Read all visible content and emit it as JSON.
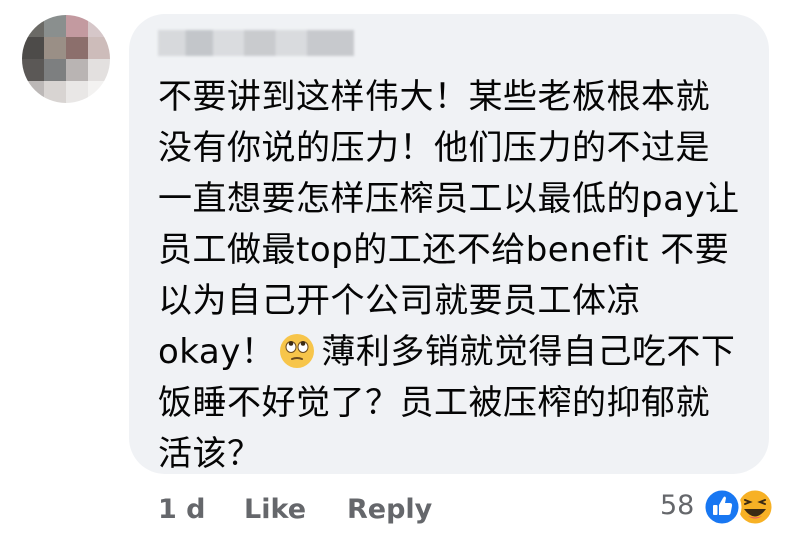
{
  "comment": {
    "author": "████████",
    "lines": [
      "不要讲到这样伟大！某些老板根本就",
      "没有你说的压力！他们压力的不过是",
      "一直想要怎样压榨员工以最低的pay让",
      "员工做最top的工还不给benefit 不要",
      "以为自己开个公司就要员工体凉",
      "okay！",
      "薄利多销就觉得自己吃不下",
      "饭睡不好觉了？员工被压榨的抑郁就",
      "活该？"
    ],
    "emoji": "rolling-eyes-emoji"
  },
  "actions": {
    "time": "1 d",
    "like": "Like",
    "reply": "Reply"
  },
  "reactions": {
    "count": "58",
    "icons": [
      "like-reaction-icon",
      "haha-reaction-icon"
    ],
    "like_color": "#1877f2",
    "haha_color": "#f7b125"
  }
}
